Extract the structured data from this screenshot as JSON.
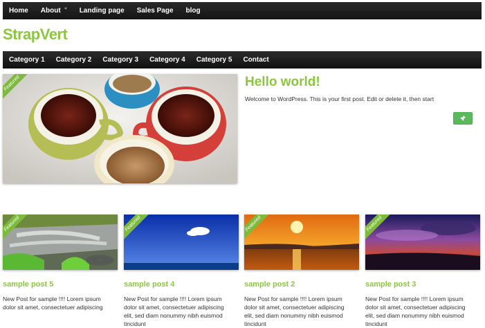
{
  "top_nav": {
    "items": [
      "Home",
      "About",
      "Landing page",
      "Sales Page",
      "blog"
    ]
  },
  "brand": "StrapVert",
  "category_nav": {
    "items": [
      "Category 1",
      "Category 2",
      "Category 3",
      "Category 4",
      "Category 5",
      "Contact"
    ]
  },
  "featured": {
    "ribbon": "Featured",
    "title": "Hello world!",
    "excerpt": "Welcome to WordPress. This is your first post. Edit or delete it, then start"
  },
  "posts": [
    {
      "ribbon": "Featured",
      "title": "sample post 5",
      "text": "New Post for sample !!!!  Lorem ipsum dolor sit amet, consectetuer adipiscing"
    },
    {
      "ribbon": "Featured",
      "title": "sample post 4",
      "text": "New Post for sample !!!!  Lorem ipsum dolor sit amet, consectetuer adipiscing elit, sed diam nonummy nibh euismod tincidunt"
    },
    {
      "ribbon": "Featured",
      "title": "sample post 2",
      "text": "New Post for sample !!!!  Lorem ipsum dolor sit amet, consectetuer adipiscing elit, sed diam nonummy nibh euismod tincidunt"
    },
    {
      "ribbon": "Featured",
      "title": "sample post 3",
      "text": "New Post for sample !!!!  Lorem ipsum dolor sit amet, consectetuer adipiscing elit, sed diam nonummy nibh euismod tincidunt"
    }
  ],
  "colors": {
    "accent": "#8cc63f",
    "nav_bg": "#1a1a1a",
    "button_green": "#5cb85c"
  },
  "icons": {
    "pin": "pushpin-icon",
    "dropdown": "caret-down-icon"
  }
}
